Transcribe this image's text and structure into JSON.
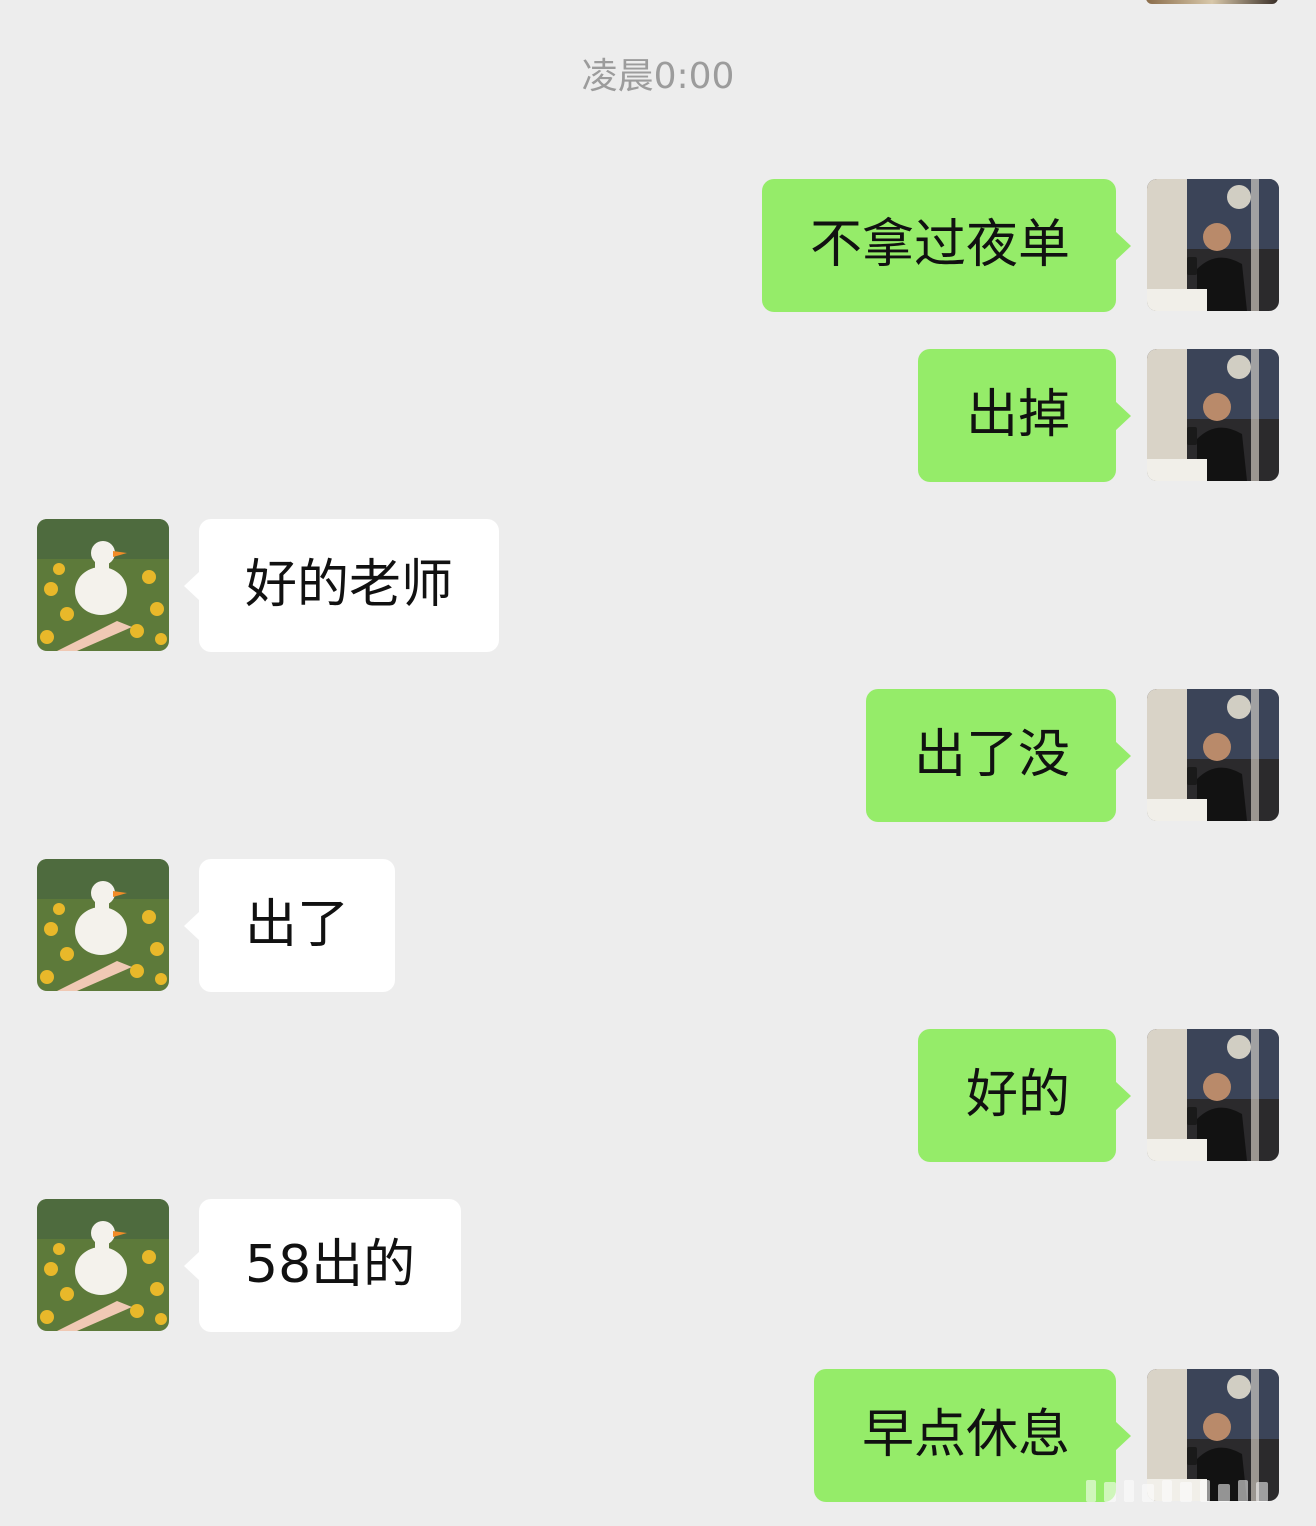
{
  "timestamp": "凌晨0:00",
  "messages": [
    {
      "sender": "me",
      "text": "不拿过夜单"
    },
    {
      "sender": "me",
      "text": "出掉"
    },
    {
      "sender": "them",
      "text": "好的老师"
    },
    {
      "sender": "me",
      "text": "出了没"
    },
    {
      "sender": "them",
      "text": "出了"
    },
    {
      "sender": "me",
      "text": "好的"
    },
    {
      "sender": "them",
      "text": "58出的"
    },
    {
      "sender": "me",
      "text": "早点休息"
    }
  ],
  "avatars": {
    "me": "man-at-restaurant-avatar",
    "them": "white-duck-sunflowers-avatar"
  },
  "colors": {
    "background": "#ededed",
    "outgoing_bubble": "#95ec69",
    "incoming_bubble": "#ffffff",
    "timestamp_text": "#9c9c9c"
  }
}
